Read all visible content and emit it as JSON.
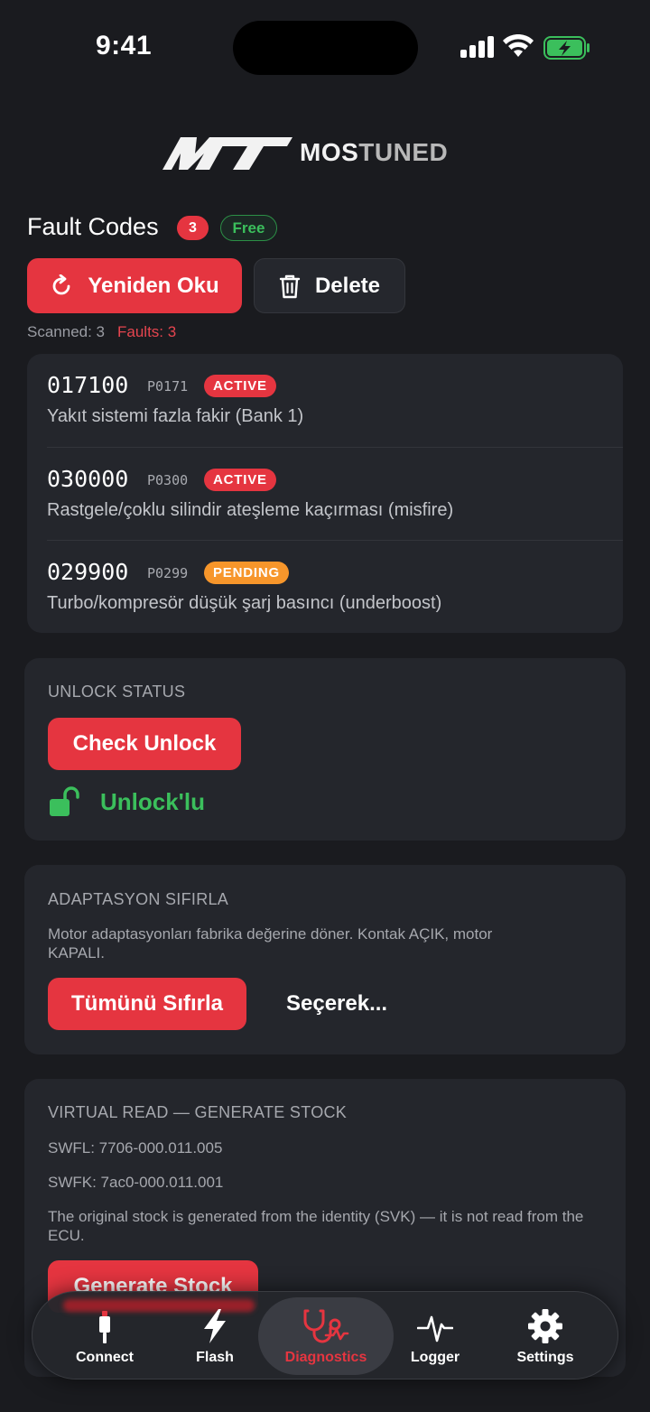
{
  "status_bar": {
    "time": "9:41"
  },
  "brand": {
    "word_a": "MOS",
    "word_b": "TUNED",
    "mark": "MT"
  },
  "header": {
    "title": "Fault Codes",
    "count": "3",
    "plan_badge": "Free"
  },
  "actions": {
    "reread_label": "Yeniden Oku",
    "delete_label": "Delete"
  },
  "scan": {
    "scanned": "Scanned: 3",
    "faults": "Faults: 3"
  },
  "faults": [
    {
      "code": "017100",
      "pcode": "P0171",
      "status": "ACTIVE",
      "desc": "Yakıt sistemi fazla fakir (Bank 1)"
    },
    {
      "code": "030000",
      "pcode": "P0300",
      "status": "ACTIVE",
      "desc": "Rastgele/çoklu silindir ateşleme kaçırması (misfire)"
    },
    {
      "code": "029900",
      "pcode": "P0299",
      "status": "PENDING",
      "desc": "Turbo/kompresör düşük şarj basıncı (underboost)"
    }
  ],
  "unlock": {
    "title": "UNLOCK STATUS",
    "button": "Check Unlock",
    "result": "Unlock'lu"
  },
  "adaptation": {
    "title": "ADAPTASYON SIFIRLA",
    "desc": "Motor adaptasyonları fabrika değerine döner. Kontak AÇIK, motor KAPALI.",
    "reset_all": "Tümünü Sıfırla",
    "select": "Seçerek..."
  },
  "virtual_read": {
    "title": "VIRTUAL READ — GENERATE STOCK",
    "swfl": "SWFL: 7706-000.011.005",
    "swfk": "SWFK: 7ac0-000.011.001",
    "desc": "The original stock is generated from the identity (SVK) — it is not read from the ECU.",
    "button": "Generate Stock"
  },
  "nav": {
    "items": [
      {
        "label": "Connect",
        "icon": "plug-icon"
      },
      {
        "label": "Flash",
        "icon": "lightning-icon"
      },
      {
        "label": "Diagnostics",
        "icon": "stethoscope-icon"
      },
      {
        "label": "Logger",
        "icon": "pulse-icon"
      },
      {
        "label": "Settings",
        "icon": "gear-icon"
      }
    ],
    "selected": "Diagnostics"
  },
  "colors": {
    "accent": "#e53540",
    "success": "#3bbf5c",
    "pending": "#f7962b",
    "background": "#1a1b1f",
    "card": "#24262c"
  }
}
